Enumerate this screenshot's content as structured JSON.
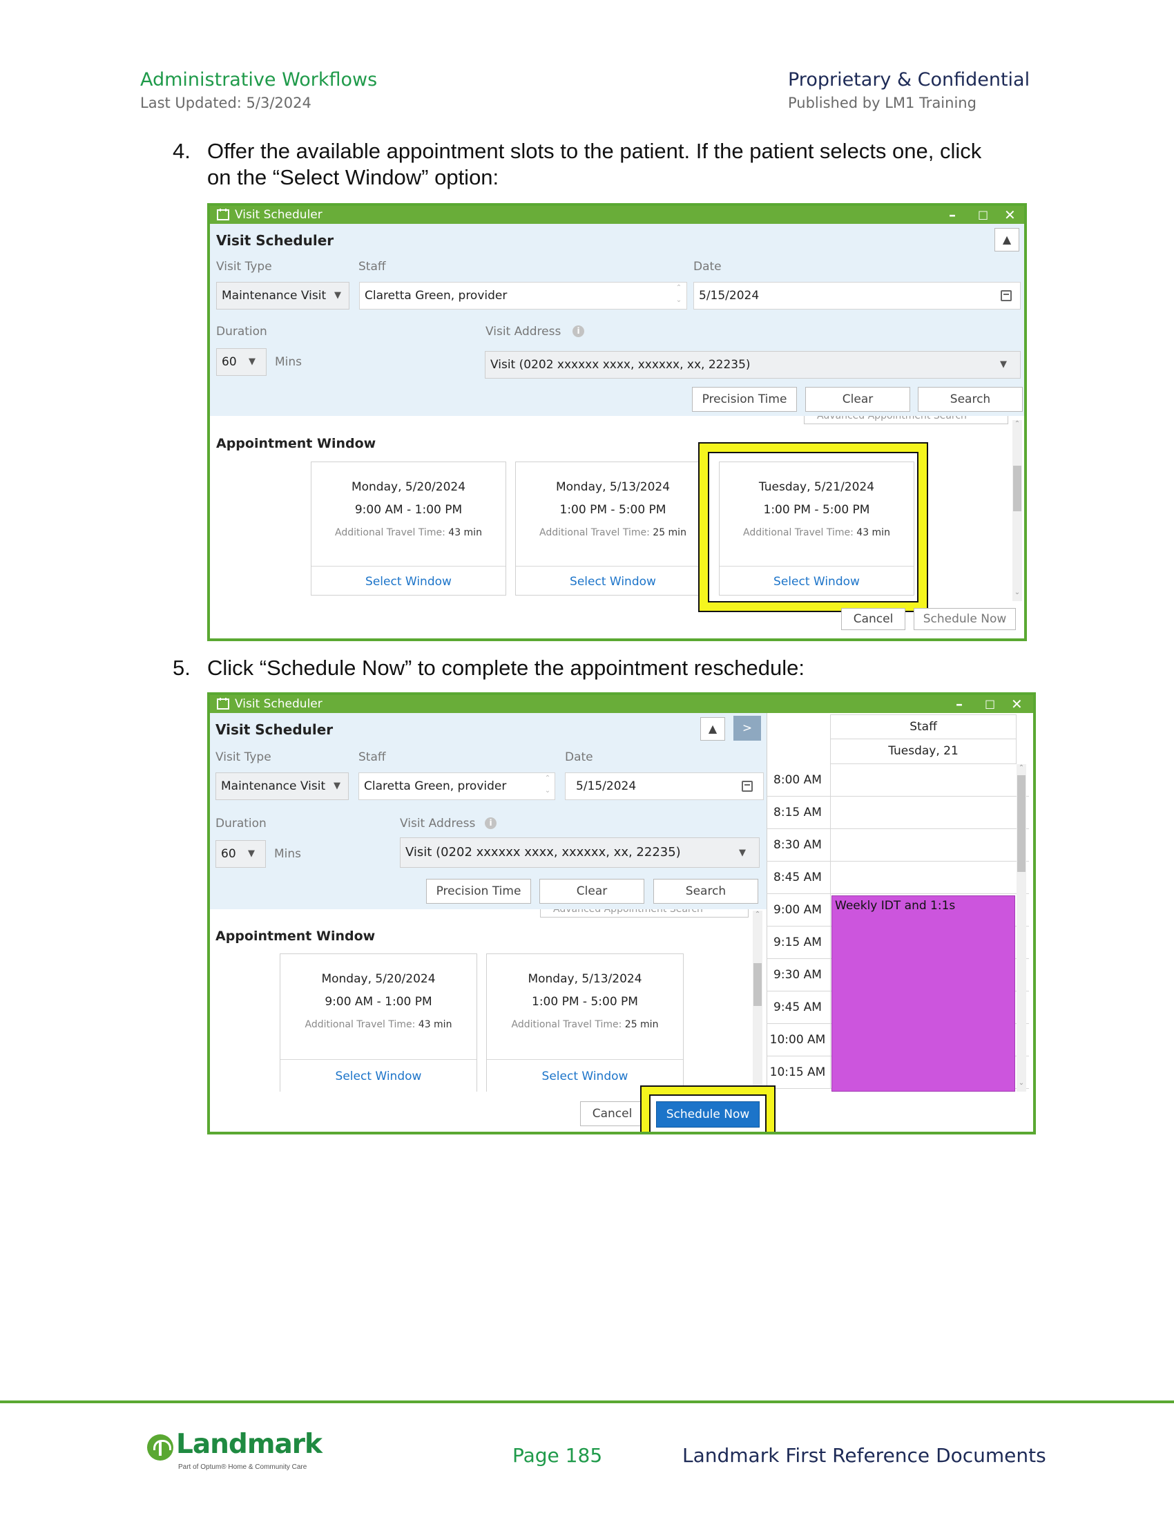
{
  "header": {
    "left_title": "Administrative Workflows",
    "left_sub": "Last Updated: 5/3/2024",
    "right_title": "Proprietary & Confidential",
    "right_sub": "Published by LM1 Training"
  },
  "steps": [
    {
      "num": "4.",
      "text": "Offer the available appointment slots to the patient. If the patient selects one, click on the “Select Window” option:"
    },
    {
      "num": "5.",
      "text": "Click “Schedule Now” to complete the appointment reschedule:"
    }
  ],
  "scheduler": {
    "window_title": "Visit Scheduler",
    "heading": "Visit Scheduler",
    "visit_type_label": "Visit Type",
    "visit_type_value": "Maintenance Visit",
    "staff_label": "Staff",
    "staff_value": "Claretta Green, provider",
    "date_label": "Date",
    "date_value": "5/15/2024",
    "duration_label": "Duration",
    "duration_value": "60",
    "mins_label": "Mins",
    "address_label": "Visit Address",
    "address_value": "Visit (0202 xxxxxx xxxx, xxxxxx, xx, 22235)",
    "precision_time": "Precision Time",
    "clear": "Clear",
    "search": "Search",
    "advanced_search": "Advanced Appointment Search",
    "appointment_window": "Appointment Window",
    "select_window": "Select Window",
    "travel_label": "Additional Travel Time:",
    "cancel": "Cancel",
    "schedule_now": "Schedule Now",
    "windows": [
      {
        "day": "Monday, 5/20/2024",
        "time": "9:00 AM - 1:00 PM",
        "travel": "43 min"
      },
      {
        "day": "Monday, 5/13/2024",
        "time": "1:00 PM - 5:00 PM",
        "travel": "25 min"
      },
      {
        "day": "Tuesday, 5/21/2024",
        "time": "1:00 PM - 5:00 PM",
        "travel": "43 min"
      }
    ],
    "calendar": {
      "staff_header": "Staff",
      "day_header": "Tuesday, 21",
      "times": [
        "8:00 AM",
        "8:15 AM",
        "8:30 AM",
        "8:45 AM",
        "9:00 AM",
        "9:15 AM",
        "9:30 AM",
        "9:45 AM",
        "10:00 AM",
        "10:15 AM"
      ],
      "appointment": "Weekly IDT and 1:1s",
      "appointment_color": "#cc55dd"
    }
  },
  "footer": {
    "logo_word": "Landmark",
    "logo_tag": "Part of Optum® Home & Community Care",
    "page": "Page 185",
    "right": "Landmark First Reference Documents"
  },
  "colors": {
    "brand_green": "#5aa832",
    "highlight": "#f5f51e",
    "link_blue": "#1c74c9"
  }
}
